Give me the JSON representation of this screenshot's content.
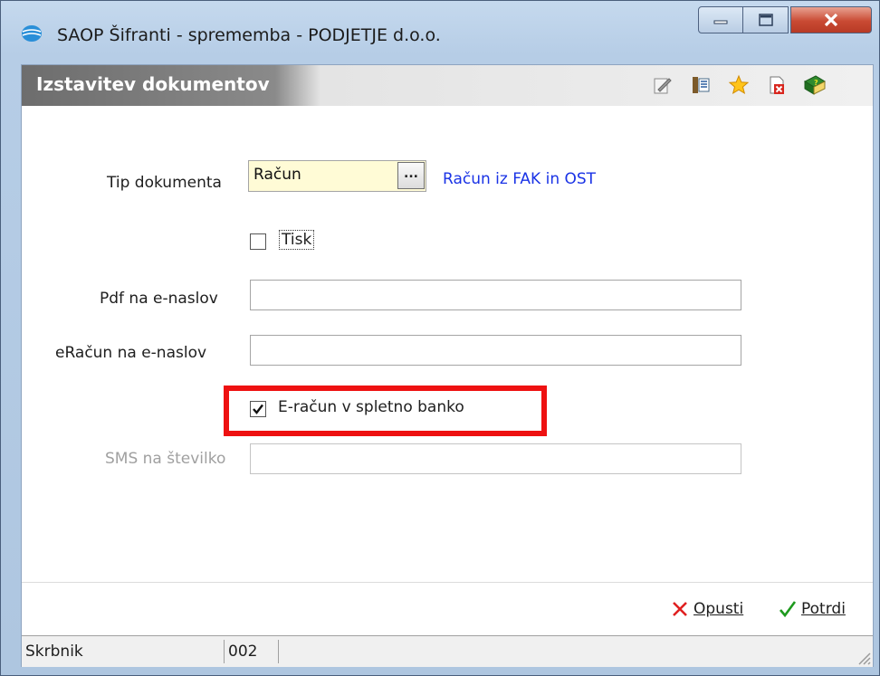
{
  "window": {
    "title": "SAOP Šifranti - sprememba - PODJETJE d.o.o."
  },
  "header": {
    "title": "Izstavitev dokumentov",
    "toolbar_icons": [
      "edit-icon",
      "list-icon",
      "star-icon",
      "delete-icon",
      "book-icon"
    ]
  },
  "form": {
    "tip_dokumenta": {
      "label": "Tip dokumenta",
      "value": "Račun",
      "browse_label": "...",
      "description": "Račun iz FAK in OST"
    },
    "tisk": {
      "label": "Tisk",
      "checked": false
    },
    "pdf_email": {
      "label": "Pdf na e-naslov",
      "value": ""
    },
    "eracun_email": {
      "label": "eRačun na e-naslov",
      "value": ""
    },
    "eracun_bank": {
      "label": "E-račun v spletno banko",
      "checked": true
    },
    "sms": {
      "label": "SMS na številko",
      "value": "",
      "disabled": true
    }
  },
  "actions": {
    "cancel_label": "Opusti",
    "confirm_label": "Potrdi"
  },
  "statusbar": {
    "user": "Skrbnik",
    "code": "002",
    "extra": ""
  },
  "colors": {
    "highlight": "#ee1111",
    "link": "#1a33e6",
    "field_yellow": "#fffbd6"
  }
}
